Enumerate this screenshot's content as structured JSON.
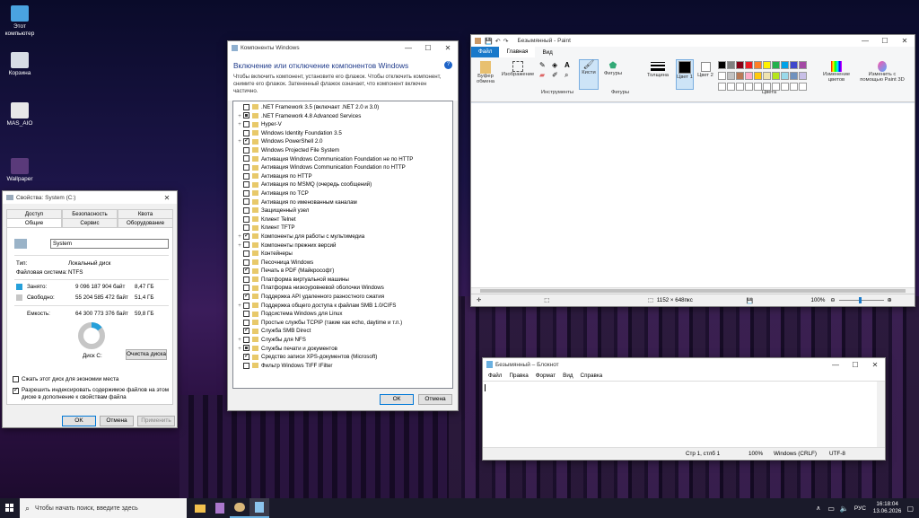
{
  "desktop": {
    "icons": [
      {
        "label": "Этот компьютер"
      },
      {
        "label": "Корзина"
      },
      {
        "label": "MAS_AIO"
      },
      {
        "label": "Wallpaper"
      }
    ]
  },
  "props": {
    "title": "Свойства: System (C:)",
    "tabs_top": [
      "Доступ",
      "Безопасность",
      "Квота"
    ],
    "tabs_bottom": [
      "Общие",
      "Сервис",
      "Оборудование"
    ],
    "name_value": "System",
    "type_label": "Тип:",
    "type_value": "Локальный диск",
    "fs_label": "Файловая система:",
    "fs_value": "NTFS",
    "used_label": "Занято:",
    "used_bytes": "9 096 187 904 байт",
    "used_gb": "8,47 ГБ",
    "free_label": "Свободно:",
    "free_bytes": "55 204 585 472 байт",
    "free_gb": "51,4 ГБ",
    "cap_label": "Емкость:",
    "cap_bytes": "64 300 773 376 байт",
    "cap_gb": "59,8 ГБ",
    "used_fraction": 0.14,
    "disk_label": "Диск C:",
    "cleanup": "Очистка диска",
    "compress": "Сжать этот диск для экономии места",
    "index": "Разрешить индексировать содержимое файлов на этом диске в дополнение к свойствам файла",
    "ok": "OK",
    "cancel": "Отмена",
    "apply": "Применить",
    "colors": {
      "used": "#26a0da",
      "free": "#c6c6c6"
    }
  },
  "features": {
    "title": "Компоненты Windows",
    "heading": "Включение или отключение компонентов Windows",
    "desc": "Чтобы включить компонент, установите его флажок. Чтобы отключить компонент, снимите его флажок. Затененный флажок означает, что компонент включен частично.",
    "ok": "ОК",
    "cancel": "Отмена",
    "items": [
      {
        "exp": "",
        "state": "off",
        "label": ".NET Framework 3.5 (включает .NET 2.0 и 3.0)"
      },
      {
        "exp": "+",
        "state": "part",
        "label": ".NET Framework 4.8 Advanced Services"
      },
      {
        "exp": "+",
        "state": "off",
        "label": "Hyper-V"
      },
      {
        "exp": "",
        "state": "off",
        "label": "Windows Identity Foundation 3.5"
      },
      {
        "exp": "+",
        "state": "on",
        "label": "Windows PowerShell 2.0"
      },
      {
        "exp": "",
        "state": "off",
        "label": "Windows Projected File System"
      },
      {
        "exp": "",
        "state": "off",
        "label": "Активация Windows Communication Foundation не по HTTP"
      },
      {
        "exp": "",
        "state": "off",
        "label": "Активация Windows Communication Foundation по HTTP"
      },
      {
        "exp": "",
        "state": "off",
        "label": "Активация по HTTP"
      },
      {
        "exp": "",
        "state": "off",
        "label": "Активация по MSMQ (очередь сообщений)"
      },
      {
        "exp": "",
        "state": "off",
        "label": "Активация по TCP"
      },
      {
        "exp": "",
        "state": "off",
        "label": "Активация по именованным каналам"
      },
      {
        "exp": "",
        "state": "off",
        "label": "Защищенный узел"
      },
      {
        "exp": "",
        "state": "off",
        "label": "Клиент Telnet"
      },
      {
        "exp": "",
        "state": "off",
        "label": "Клиент TFTP"
      },
      {
        "exp": "+",
        "state": "on",
        "label": "Компоненты для работы с мультимедиа"
      },
      {
        "exp": "+",
        "state": "off",
        "label": "Компоненты прежних версий"
      },
      {
        "exp": "",
        "state": "off",
        "label": "Контейнеры"
      },
      {
        "exp": "",
        "state": "off",
        "label": "Песочница Windows"
      },
      {
        "exp": "",
        "state": "on",
        "label": "Печать в PDF (Майкрософт)"
      },
      {
        "exp": "",
        "state": "off",
        "label": "Платформа виртуальной машины"
      },
      {
        "exp": "",
        "state": "off",
        "label": "Платформа низкоуровневой оболочки Windows"
      },
      {
        "exp": "",
        "state": "on",
        "label": "Поддержка API удаленного разностного сжатия"
      },
      {
        "exp": "+",
        "state": "off",
        "label": "Поддержка общего доступа к файлам SMB 1.0/CIFS"
      },
      {
        "exp": "",
        "state": "off",
        "label": "Подсистема Windows для Linux"
      },
      {
        "exp": "",
        "state": "off",
        "label": "Простые службы TCPIP (такие как echo, daytime и т.п.)"
      },
      {
        "exp": "",
        "state": "on",
        "label": "Служба SMB Direct"
      },
      {
        "exp": "+",
        "state": "off",
        "label": "Службы для NFS"
      },
      {
        "exp": "+",
        "state": "part",
        "label": "Службы печати и документов"
      },
      {
        "exp": "",
        "state": "on",
        "label": "Средство записи XPS-документов (Microsoft)"
      },
      {
        "exp": "",
        "state": "off",
        "label": "Фильтр Windows TIFF IFilter"
      }
    ]
  },
  "paint": {
    "title": "Безымянный - Paint",
    "tabs": [
      "Файл",
      "Главная",
      "Вид"
    ],
    "groups": {
      "clipboard": "Буфер обмена",
      "image": "Изображение",
      "tools": "Инструменты",
      "brushes": "Кисти",
      "shapes": "Фигуры",
      "size": "Толщина",
      "color1": "Цвет 1",
      "color2": "Цвет 2",
      "colors": "Цвета",
      "edit_colors": "Изменение цветов",
      "paint3d": "Изменить с помощью Paint 3D",
      "shapes_group": "Фигуры"
    },
    "status_size": "1152 × 648пкс",
    "zoom": "100%",
    "palette": [
      "#000000",
      "#7f7f7f",
      "#880015",
      "#ed1c24",
      "#ff7f27",
      "#fff200",
      "#22b14c",
      "#00a2e8",
      "#3f48cc",
      "#a349a4",
      "#ffffff",
      "#c3c3c3",
      "#b97a57",
      "#ffaec9",
      "#ffc90e",
      "#efe4b0",
      "#b5e61d",
      "#99d9ea",
      "#7092be",
      "#c8bfe7"
    ]
  },
  "notepad": {
    "title": "Безымянный – Блокнот",
    "menu": [
      "Файл",
      "Правка",
      "Формат",
      "Вид",
      "Справка"
    ],
    "pos": "Стр 1, стлб 1",
    "zoom": "100%",
    "eol": "Windows (CRLF)",
    "enc": "UTF-8"
  },
  "taskbar": {
    "search": "Чтобы начать поиск, введите здесь",
    "lang": "РУС",
    "time": "16:18:04",
    "date": "13.06.2026"
  }
}
